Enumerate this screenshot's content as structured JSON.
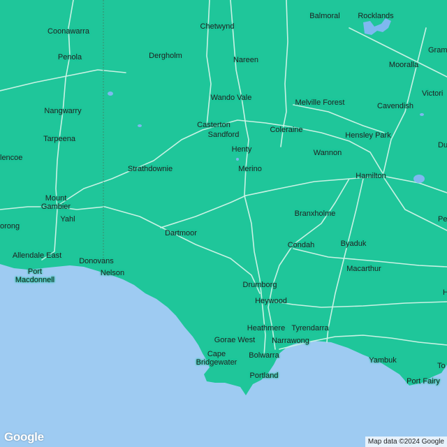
{
  "map": {
    "colors": {
      "land": "#1fc69a",
      "water": "#9ecbf2",
      "roads": "#c9f2e4",
      "lakes": "#7fb8f0"
    },
    "places": [
      {
        "id": "coonawarra",
        "label": "Coonawarra"
      },
      {
        "id": "chetwynd",
        "label": "Chetwynd"
      },
      {
        "id": "balmoral",
        "label": "Balmoral"
      },
      {
        "id": "rocklands",
        "label": "Rocklands"
      },
      {
        "id": "penola",
        "label": "Penola"
      },
      {
        "id": "dergholm",
        "label": "Dergholm"
      },
      {
        "id": "nareen",
        "label": "Nareen"
      },
      {
        "id": "mooralla",
        "label": "Mooralla"
      },
      {
        "id": "gram",
        "label": "Gram"
      },
      {
        "id": "wando-vale",
        "label": "Wando Vale"
      },
      {
        "id": "victoria",
        "label": "Victori"
      },
      {
        "id": "melville-forest",
        "label": "Melville Forest"
      },
      {
        "id": "cavendish",
        "label": "Cavendish"
      },
      {
        "id": "nangwarry",
        "label": "Nangwarry"
      },
      {
        "id": "casterton",
        "label": "Casterton"
      },
      {
        "id": "sandford",
        "label": "Sandford"
      },
      {
        "id": "coleraine",
        "label": "Coleraine"
      },
      {
        "id": "hensley-park",
        "label": "Hensley Park"
      },
      {
        "id": "tarpeena",
        "label": "Tarpeena"
      },
      {
        "id": "henty",
        "label": "Henty"
      },
      {
        "id": "wannon",
        "label": "Wannon"
      },
      {
        "id": "du",
        "label": "Du"
      },
      {
        "id": "glencoe",
        "label": "lencoe"
      },
      {
        "id": "strathdownie",
        "label": "Strathdownie"
      },
      {
        "id": "merino",
        "label": "Merino"
      },
      {
        "id": "hamilton",
        "label": "Hamilton"
      },
      {
        "id": "mount-gambier",
        "lines": [
          "Mount",
          "Gambier"
        ]
      },
      {
        "id": "branxholme",
        "label": "Branxholme"
      },
      {
        "id": "yahl",
        "label": "Yahl"
      },
      {
        "id": "penshurst",
        "label": "Penshu"
      },
      {
        "id": "dartmoor",
        "label": "Dartmoor"
      },
      {
        "id": "orong",
        "label": "orong"
      },
      {
        "id": "condah",
        "label": "Condah"
      },
      {
        "id": "byaduk",
        "label": "Byaduk"
      },
      {
        "id": "allendale-east",
        "label": "Allendale East"
      },
      {
        "id": "donovans",
        "label": "Donovans"
      },
      {
        "id": "macarthur",
        "label": "Macarthur"
      },
      {
        "id": "port-macdonnell",
        "lines": [
          "Port",
          "Macdonnell"
        ]
      },
      {
        "id": "nelson",
        "label": "Nelson"
      },
      {
        "id": "drumborg",
        "label": "Drumborg"
      },
      {
        "id": "hawkesdale",
        "label": "Hawke"
      },
      {
        "id": "heywood",
        "label": "Heywood"
      },
      {
        "id": "heathmere",
        "label": "Heathmere"
      },
      {
        "id": "tyrendarra",
        "label": "Tyrendarra"
      },
      {
        "id": "gorae-west",
        "label": "Gorae West"
      },
      {
        "id": "narrawong",
        "label": "Narrawong"
      },
      {
        "id": "cape-bridgewater",
        "lines": [
          "Cape",
          "Bridgewater"
        ]
      },
      {
        "id": "bolwarra",
        "label": "Bolwarra"
      },
      {
        "id": "yambuk",
        "label": "Yambuk"
      },
      {
        "id": "portland",
        "label": "Portland"
      },
      {
        "id": "port-fairy",
        "label": "Port Fairy"
      },
      {
        "id": "to",
        "label": "To"
      }
    ]
  },
  "branding": {
    "logo": "Google"
  },
  "attribution": "Map data ©2024 Google"
}
